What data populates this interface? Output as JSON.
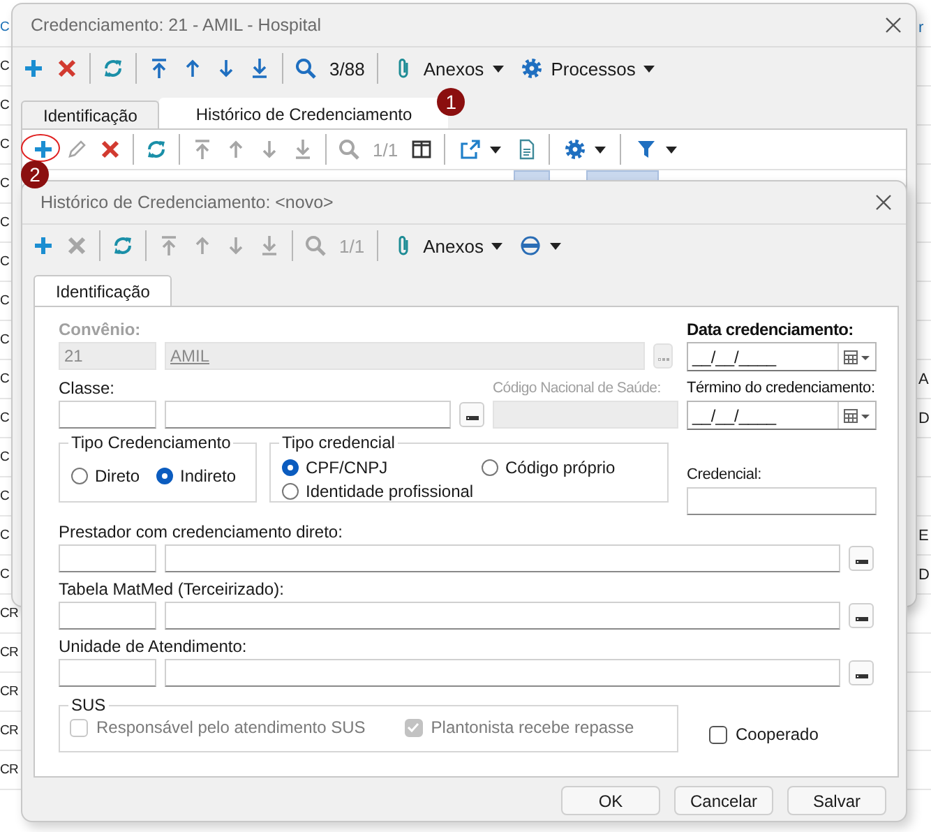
{
  "background": {
    "rows": [
      {
        "left": "C",
        "right": "r",
        "link": true
      },
      {
        "left": "C",
        "link": false
      },
      {
        "left": "C",
        "link": false
      },
      {
        "left": "C",
        "link": false
      },
      {
        "left": "C",
        "link": false
      },
      {
        "left": "C",
        "link": false
      },
      {
        "left": "C",
        "link": false
      },
      {
        "left": "C",
        "link": false
      },
      {
        "left": "C",
        "link": false
      },
      {
        "left": "C",
        "right": "A",
        "link": false
      },
      {
        "left": "C",
        "right": "D",
        "link": false
      },
      {
        "left": "C",
        "link": false
      },
      {
        "left": "C",
        "link": false
      },
      {
        "left": "C",
        "right": "E",
        "link": false
      },
      {
        "left": "C",
        "right": "D",
        "link": false
      },
      {
        "left": "CR",
        "link": false
      },
      {
        "left": "CR",
        "link": false
      },
      {
        "left": "CR",
        "link": false
      },
      {
        "left": "CR",
        "link": false
      },
      {
        "left": "CR",
        "link": false
      }
    ]
  },
  "outer_window": {
    "title": "Credenciamento: 21 - AMIL - Hospital",
    "toolbar": [
      {
        "kind": "add",
        "disabled": false
      },
      {
        "kind": "delete",
        "disabled": false
      },
      {
        "kind": "separator"
      },
      {
        "kind": "refresh",
        "disabled": false
      },
      {
        "kind": "separator"
      },
      {
        "kind": "first",
        "disabled": false
      },
      {
        "kind": "previous",
        "disabled": false
      },
      {
        "kind": "next",
        "disabled": false
      },
      {
        "kind": "last",
        "disabled": false
      },
      {
        "kind": "separator"
      },
      {
        "kind": "search",
        "disabled": false
      },
      {
        "kind": "counter",
        "text": "3/88",
        "disabled": false
      },
      {
        "kind": "separator"
      },
      {
        "kind": "attachments",
        "label": "Anexos"
      },
      {
        "kind": "settings",
        "label": "Processos"
      }
    ],
    "tabs": [
      {
        "label": "Identificação",
        "selected": false
      },
      {
        "label": "Histórico de Credenciamento",
        "selected": true,
        "badge": "1"
      }
    ],
    "tab_toolbar": [
      {
        "kind": "add",
        "disabled": false,
        "highlighted": true,
        "badge": "2"
      },
      {
        "kind": "edit",
        "disabled": true
      },
      {
        "kind": "delete",
        "disabled": false
      },
      {
        "kind": "separator"
      },
      {
        "kind": "refresh",
        "disabled": false
      },
      {
        "kind": "separator"
      },
      {
        "kind": "first",
        "disabled": true
      },
      {
        "kind": "previous",
        "disabled": true
      },
      {
        "kind": "next",
        "disabled": true
      },
      {
        "kind": "last",
        "disabled": true
      },
      {
        "kind": "separator"
      },
      {
        "kind": "search",
        "disabled": true
      },
      {
        "kind": "counter",
        "text": "1/1",
        "disabled": true
      },
      {
        "kind": "columns",
        "disabled": false
      },
      {
        "kind": "separator"
      },
      {
        "kind": "export"
      },
      {
        "kind": "document",
        "disabled": false
      },
      {
        "kind": "separator"
      },
      {
        "kind": "settings"
      },
      {
        "kind": "separator"
      },
      {
        "kind": "filter"
      }
    ]
  },
  "dialog": {
    "title": "Histórico de Credenciamento: <novo>",
    "toolbar": [
      {
        "kind": "add",
        "disabled": false
      },
      {
        "kind": "delete",
        "disabled": true
      },
      {
        "kind": "separator"
      },
      {
        "kind": "refresh",
        "disabled": false
      },
      {
        "kind": "separator"
      },
      {
        "kind": "first",
        "disabled": true
      },
      {
        "kind": "previous",
        "disabled": true
      },
      {
        "kind": "next",
        "disabled": true
      },
      {
        "kind": "last",
        "disabled": true
      },
      {
        "kind": "separator"
      },
      {
        "kind": "search",
        "disabled": true
      },
      {
        "kind": "counter",
        "text": "1/1",
        "disabled": true
      },
      {
        "kind": "separator"
      },
      {
        "kind": "attachments",
        "label": "Anexos"
      },
      {
        "kind": "disc"
      }
    ],
    "tabs": [
      {
        "label": "Identificação",
        "selected": true
      }
    ],
    "form": {
      "convenio": {
        "label": "Convênio:",
        "code": "21",
        "name": "AMIL",
        "disabled": true
      },
      "classe": {
        "label": "Classe:"
      },
      "cns": {
        "label": "Código Nacional de Saúde:",
        "disabled": true
      },
      "data_credenciamento": {
        "label": "Data credenciamento:",
        "value": "__/__/____"
      },
      "termino": {
        "label": "Término do credenciamento:",
        "value": "__/__/____"
      },
      "tipo_credenciamento": {
        "title": "Tipo Credenciamento",
        "options": [
          {
            "label": "Direto",
            "selected": false
          },
          {
            "label": "Indireto",
            "selected": true
          }
        ]
      },
      "tipo_credencial": {
        "title": "Tipo credencial",
        "options": [
          {
            "label": "CPF/CNPJ",
            "selected": true
          },
          {
            "label": "Código próprio",
            "selected": false
          },
          {
            "label": "Identidade profissional",
            "selected": false
          }
        ]
      },
      "credencial": {
        "label": "Credencial:"
      },
      "lookups": [
        {
          "label": "Prestador com credenciamento direto:"
        },
        {
          "label": "Tabela MatMed (Terceirizado):"
        },
        {
          "label": "Unidade de Atendimento:"
        }
      ],
      "sus": {
        "title": "SUS",
        "options": [
          {
            "label": "Responsável pelo atendimento SUS",
            "checked": false,
            "disabled": true
          },
          {
            "label": "Plantonista recebe repasse",
            "checked": true,
            "disabled": true
          }
        ]
      },
      "cooperado": {
        "label": "Cooperado",
        "checked": false,
        "disabled": false
      }
    },
    "buttons": [
      {
        "label": "OK"
      },
      {
        "label": "Cancelar"
      },
      {
        "label": "Salvar"
      }
    ]
  }
}
